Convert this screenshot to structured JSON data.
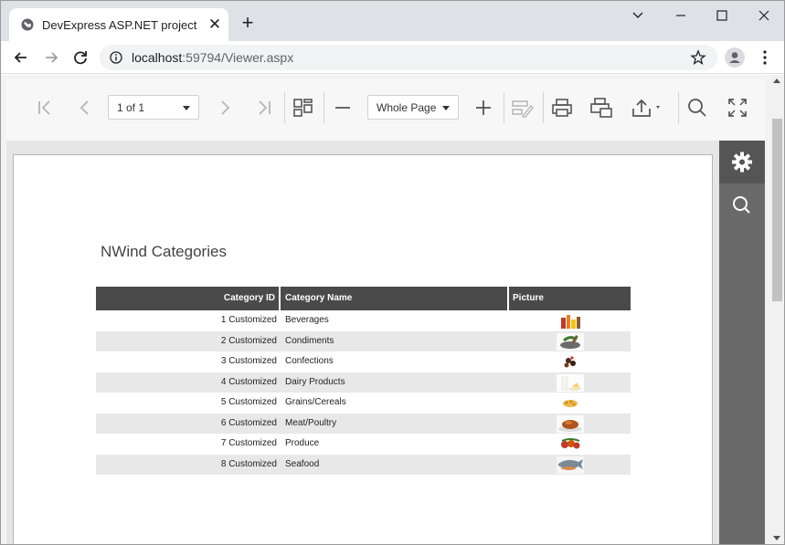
{
  "browser": {
    "tab_title": "DevExpress ASP.NET project",
    "url_host": "localhost",
    "url_rest": ":59794/Viewer.aspx"
  },
  "viewer_toolbar": {
    "page_selector": "1 of 1",
    "zoom_selector": "Whole Page",
    "icons": [
      "first-page-icon",
      "prev-page-icon",
      "next-page-icon",
      "last-page-icon",
      "multipage-icon",
      "zoom-out-icon",
      "zoom-in-icon",
      "editing-fields-icon",
      "print-icon",
      "print-page-icon",
      "export-icon",
      "search-icon",
      "fullscreen-icon"
    ]
  },
  "report": {
    "title": "NWind Categories",
    "columns": [
      "Category ID",
      "Category Name",
      "Picture"
    ],
    "rows": [
      {
        "id": "1 Customized",
        "name": "Beverages"
      },
      {
        "id": "2 Customized",
        "name": "Condiments"
      },
      {
        "id": "3 Customized",
        "name": "Confections"
      },
      {
        "id": "4 Customized",
        "name": "Dairy Products"
      },
      {
        "id": "5 Customized",
        "name": "Grains/Cereals"
      },
      {
        "id": "6 Customized",
        "name": "Meat/Poultry"
      },
      {
        "id": "7 Customized",
        "name": "Produce"
      },
      {
        "id": "8 Customized",
        "name": "Seafood"
      }
    ]
  },
  "side_panel": {
    "icons": [
      "gear-icon",
      "search-icon"
    ]
  },
  "colors": {
    "header_bg": "#4a4a4a",
    "alt_row": "#e8e8e8",
    "side_panel": "#6a6a6a"
  }
}
